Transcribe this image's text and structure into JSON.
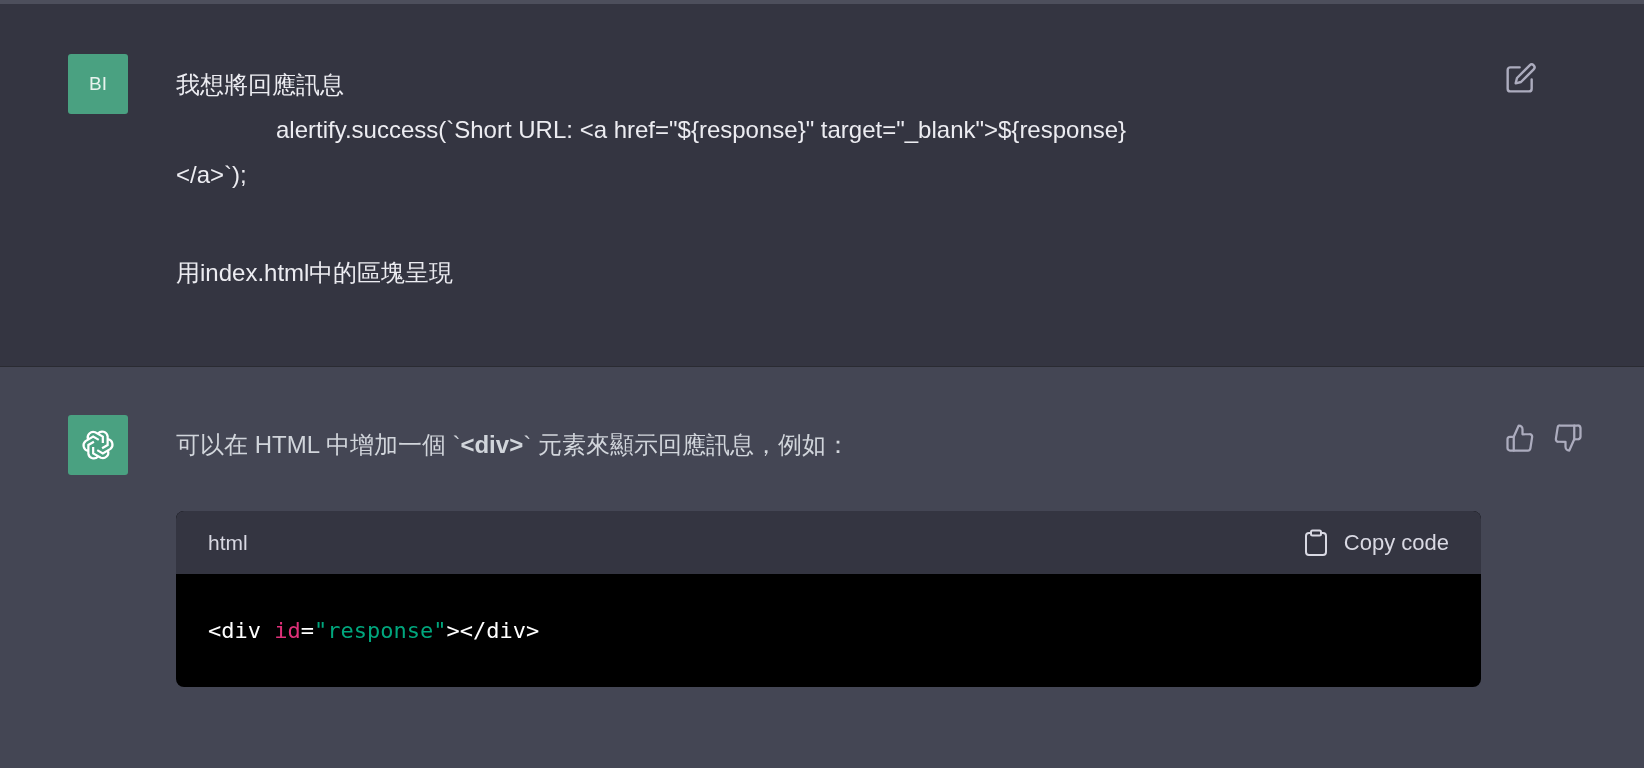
{
  "messages": [
    {
      "kind": "user",
      "avatar": "BI",
      "paragraphs": [
        [
          {
            "text": "我想將回應訊息",
            "indented": false
          },
          {
            "text": "alertify.success(`Short URL: <a href=\"${response}\" target=\"_blank\">${response}",
            "indented": true
          },
          {
            "text": "</a>`);",
            "indented": false
          }
        ],
        [
          {
            "text": "用index.html中的區塊呈現",
            "indented": false
          }
        ]
      ]
    },
    {
      "kind": "assistant",
      "text": "可以在 HTML 中增加一個 `**<div>**` 元素來顯示回應訊息，例如：",
      "code": {
        "language": "html",
        "copy_label": "Copy code",
        "tokens": [
          {
            "kind": "tag",
            "text": "<div "
          },
          {
            "kind": "attr",
            "text": "id"
          },
          {
            "kind": "tag",
            "text": "="
          },
          {
            "kind": "string",
            "text": "\"response\""
          },
          {
            "kind": "tag",
            "text": "></div>"
          }
        ]
      }
    }
  ]
}
